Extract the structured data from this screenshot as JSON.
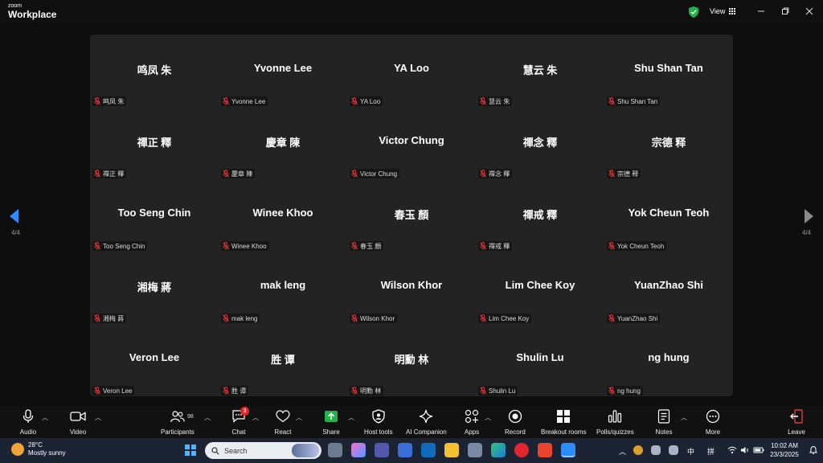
{
  "app": {
    "brand_small": "zoom",
    "brand_big": "Workplace",
    "view_label": "View"
  },
  "pagination": {
    "left": "4/4",
    "right": "4/4"
  },
  "participants": [
    [
      "鸣凤 朱",
      "Yvonne Lee",
      "YA Loo",
      "慧云 朱",
      "Shu Shan Tan"
    ],
    [
      "禪正 釋",
      "慶章 陳",
      "Victor Chung",
      "禪念 釋",
      "宗德 释"
    ],
    [
      "Too Seng Chin",
      "Winee Khoo",
      "春玉 顏",
      "禪戒 釋",
      "Yok Cheun Teoh"
    ],
    [
      "湘梅 蔣",
      "mak leng",
      "Wilson Khor",
      "Lim Chee Koy",
      "YuanZhao Shi"
    ],
    [
      "Veron Lee",
      "胜 谭",
      "明勳 林",
      "Shulin Lu",
      "ng hung"
    ]
  ],
  "toolbar": {
    "audio": "Audio",
    "video": "Video",
    "participants": "Participants",
    "participants_count": "98",
    "chat": "Chat",
    "chat_badge": "3",
    "react": "React",
    "share": "Share",
    "host_tools": "Host tools",
    "ai_companion": "AI Companion",
    "apps": "Apps",
    "record": "Record",
    "breakout_rooms": "Breakout rooms",
    "polls": "Polls/quizzes",
    "notes": "Notes",
    "more": "More",
    "leave": "Leave"
  },
  "taskbar": {
    "temperature": "28°C",
    "weather": "Mostly sunny",
    "search_placeholder": "Search",
    "ime_1": "中",
    "ime_2": "拼",
    "time": "10:02 AM",
    "date": "23/3/2025"
  },
  "colors": {
    "share_green": "#22b24c",
    "badge_red": "#e02828",
    "mute_red": "#e0383e",
    "accent_blue": "#2d8cff"
  }
}
